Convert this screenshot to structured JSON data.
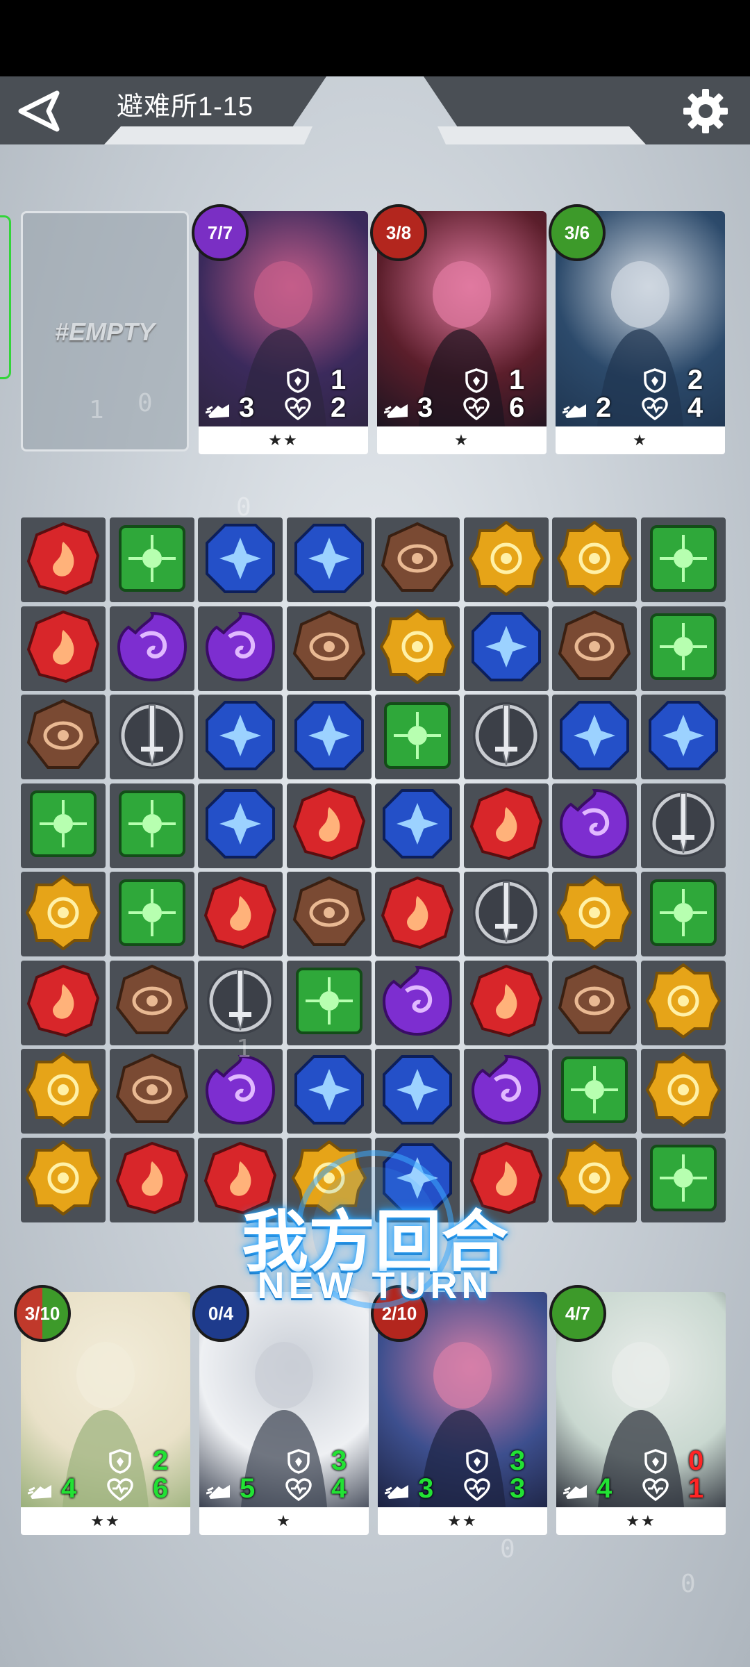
{
  "header": {
    "level_title": "避难所1-15",
    "back_icon": "back-triangle-icon",
    "settings_icon": "gear-icon"
  },
  "enemy_row": {
    "empty_slot_label": "#EMPTY",
    "cards": [
      {
        "badge": "7/7",
        "badge_color": "#7a2fc4",
        "speed": "3",
        "defense": "1",
        "hp": "2",
        "stars": "★★",
        "art_colors": [
          "#3b2a5c",
          "#c45e8a",
          "#2e2540"
        ]
      },
      {
        "badge": "3/8",
        "badge_color": "#b3261e",
        "speed": "3",
        "defense": "1",
        "hp": "6",
        "stars": "★",
        "art_colors": [
          "#5b1e2b",
          "#e07aa0",
          "#1c1420"
        ]
      },
      {
        "badge": "3/6",
        "badge_color": "#3d9a2a",
        "speed": "2",
        "defense": "2",
        "hp": "4",
        "stars": "★",
        "art_colors": [
          "#2c4a6b",
          "#cfd7e0",
          "#1f3550"
        ]
      }
    ]
  },
  "board": {
    "rows": [
      [
        "fire",
        "nature",
        "water",
        "water",
        "earth",
        "sun",
        "sun",
        "nature"
      ],
      [
        "fire",
        "shadow",
        "shadow",
        "earth",
        "sun",
        "water",
        "earth",
        "nature"
      ],
      [
        "earth",
        "sword",
        "water",
        "water",
        "nature",
        "sword",
        "water",
        "water"
      ],
      [
        "nature",
        "nature",
        "water",
        "fire",
        "water",
        "fire",
        "shadow",
        "sword"
      ],
      [
        "sun",
        "nature",
        "fire",
        "earth",
        "fire",
        "sword",
        "sun",
        "nature"
      ],
      [
        "fire",
        "earth",
        "sword",
        "nature",
        "shadow",
        "fire",
        "earth",
        "sun"
      ],
      [
        "sun",
        "earth",
        "shadow",
        "water",
        "water",
        "shadow",
        "nature",
        "sun"
      ],
      [
        "sun",
        "fire",
        "fire",
        "sun",
        "water",
        "fire",
        "sun",
        "nature"
      ]
    ],
    "gem_colors": {
      "fire": "#d8262a",
      "nature": "#2fa83a",
      "water": "#2450c8",
      "earth": "#7a4a33",
      "sun": "#e6a418",
      "shadow": "#7d2ed0",
      "sword": "#8b8f96"
    }
  },
  "turn_banner": {
    "cn": "我方回合",
    "en": "NEW  TURN"
  },
  "player_row": {
    "cards": [
      {
        "badge": "3/10",
        "badge_color": "#c0392b",
        "badge_color2": "#3d9a2a",
        "speed": "4",
        "defense": "2",
        "hp": "6",
        "stars": "★★",
        "def_color": "green",
        "hp_color": "green",
        "art_colors": [
          "#e9e1c8",
          "#f2ecd9",
          "#9ab07a"
        ]
      },
      {
        "badge": "0/4",
        "badge_color": "#1e3b8c",
        "speed": "5",
        "defense": "3",
        "hp": "4",
        "stars": "★",
        "def_color": "green",
        "hp_color": "green",
        "art_colors": [
          "#eef0f3",
          "#c9ced6",
          "#3a4150"
        ]
      },
      {
        "badge": "2/10",
        "badge_color": "#b3261e",
        "speed": "3",
        "defense": "3",
        "hp": "3",
        "stars": "★★",
        "def_color": "green",
        "hp_color": "green",
        "art_colors": [
          "#3d4f8e",
          "#d67fa8",
          "#1c2240"
        ]
      },
      {
        "badge": "4/7",
        "badge_color": "#3d9a2a",
        "speed": "4",
        "defense": "0",
        "hp": "1",
        "stars": "★★",
        "def_color": "red",
        "hp_color": "red",
        "art_colors": [
          "#c9d8d0",
          "#e8ece9",
          "#2a2e38"
        ]
      }
    ]
  },
  "icons": {
    "speed": "boot-icon",
    "defense": "shield-icon",
    "hp": "heart-icon"
  },
  "watermarks": [
    "1",
    "0",
    "1",
    "0",
    "0",
    "0"
  ]
}
